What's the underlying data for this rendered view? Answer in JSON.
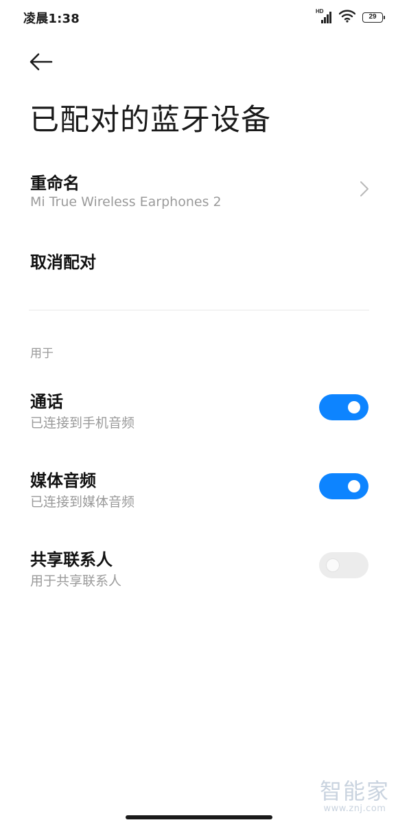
{
  "status_bar": {
    "time": "凌晨1:38",
    "hd": "HD",
    "battery": "29"
  },
  "page": {
    "title": "已配对的蓝牙设备"
  },
  "rename": {
    "title": "重命名",
    "subtitle": "Mi True Wireless Earphones 2"
  },
  "unpair": {
    "title": "取消配对"
  },
  "section": {
    "label": "用于"
  },
  "calls": {
    "title": "通话",
    "subtitle": "已连接到手机音频",
    "enabled": true
  },
  "media_audio": {
    "title": "媒体音频",
    "subtitle": "已连接到媒体音频",
    "enabled": true
  },
  "contact_sharing": {
    "title": "共享联系人",
    "subtitle": "用于共享联系人",
    "enabled": false
  },
  "watermark": {
    "logo": "智能家",
    "url": "www.znj.com"
  },
  "colors": {
    "toggle_on": "#0d84ff",
    "toggle_off": "#ececec"
  }
}
